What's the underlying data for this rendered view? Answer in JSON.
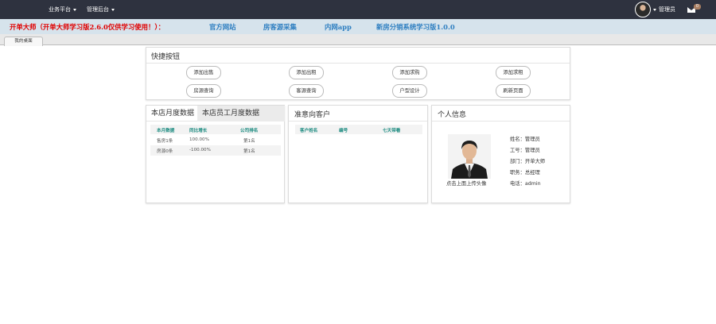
{
  "topbar": {
    "nav": [
      {
        "label": "业务平台"
      },
      {
        "label": "管理后台"
      }
    ],
    "user_name": "管理员",
    "mail_count": "0"
  },
  "banner": {
    "title": "开单大师（开单大师学习版2.6.0仅供学习使用！）：",
    "links": [
      "官方网站",
      "房客源采集",
      "内网app",
      "新房分销系统学习版1.0.0"
    ]
  },
  "tabs": [
    {
      "label": "我的桌面"
    }
  ],
  "quick": {
    "title": "快捷按钮",
    "buttons": [
      "添加出售",
      "添加出租",
      "添加求购",
      "添加求租",
      "房源查询",
      "客源查询",
      "户型设计",
      "刷新页面"
    ]
  },
  "monthly": {
    "tabs": [
      "本店月度数据",
      "本店员工月度数据"
    ],
    "columns": [
      "本月数据",
      "同比增长",
      "公司排名"
    ],
    "rows": [
      [
        "售房1条",
        "100.00%",
        "第1名"
      ],
      [
        "房源0条",
        "-100.00%",
        "第1名"
      ]
    ]
  },
  "customers": {
    "title": "准意向客户",
    "columns": [
      "客户姓名",
      "编号",
      "七天带看"
    ]
  },
  "profile": {
    "title": "个人信息",
    "photo_caption": "点击上面上传头像",
    "fields": [
      {
        "label": "姓名：",
        "value": "管理员"
      },
      {
        "label": "工号：",
        "value": "管理员"
      },
      {
        "label": "部门：",
        "value": "开单大师"
      },
      {
        "label": "职务：",
        "value": "总经理"
      },
      {
        "label": "电话：",
        "value": "admin"
      }
    ]
  },
  "colors": {
    "topbar": "#2e323f",
    "banner_bg": "#d6e3ec",
    "banner_title": "#e00000",
    "banner_link": "#2f7fc1",
    "table_header_text": "#1a8a7f"
  }
}
